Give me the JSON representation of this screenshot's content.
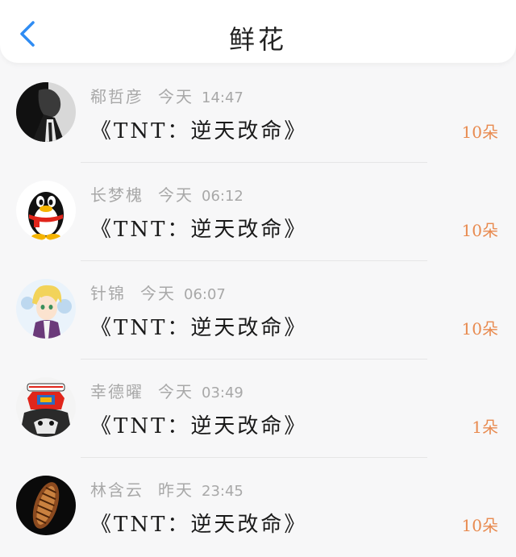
{
  "header": {
    "title": "鲜花"
  },
  "colors": {
    "accent": "#2f8cf3",
    "count": "#e88a4f",
    "meta": "#a8a8a8"
  },
  "items": [
    {
      "name": "郗哲彦",
      "day": "今天",
      "time": "14:47",
      "gift": "《TNT：逆天改命》",
      "count": "10朵",
      "avatar": "avatar-bw-portrait"
    },
    {
      "name": "长梦槐",
      "day": "今天",
      "time": "06:12",
      "gift": "《TNT：逆天改命》",
      "count": "10朵",
      "avatar": "avatar-qq-penguin"
    },
    {
      "name": "针锦",
      "day": "今天",
      "time": "06:07",
      "gift": "《TNT：逆天改命》",
      "count": "10朵",
      "avatar": "avatar-anime-boy"
    },
    {
      "name": "幸德曜",
      "day": "今天",
      "time": "03:49",
      "gift": "《TNT：逆天改命》",
      "count": "1朵",
      "avatar": "avatar-cartoon-cat"
    },
    {
      "name": "林含云",
      "day": "昨天",
      "time": "23:45",
      "gift": "《TNT：逆天改命》",
      "count": "10朵",
      "avatar": "avatar-shell"
    }
  ]
}
